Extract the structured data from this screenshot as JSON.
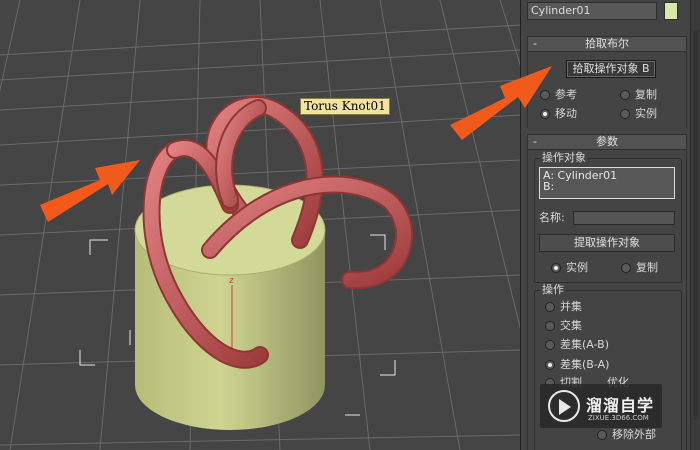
{
  "viewport": {
    "object_label": "Torus Knot01",
    "axis_label": "z"
  },
  "panel": {
    "object_name": "Cylinder01",
    "object_color": "#d8e8a8",
    "pick_rollout": {
      "title": "拾取布尔",
      "collapse_symbol": "-",
      "pick_button": "拾取操作对象 B",
      "radios": [
        {
          "label": "参考",
          "selected": false
        },
        {
          "label": "复制",
          "selected": false
        },
        {
          "label": "移动",
          "selected": true
        },
        {
          "label": "实例",
          "selected": false
        }
      ]
    },
    "params_rollout": {
      "title": "参数",
      "collapse_symbol": "-",
      "operands_group": {
        "title": "操作对象",
        "list": [
          "A: Cylinder01",
          "B:"
        ],
        "name_label": "名称:",
        "name_value": "",
        "extract_button": "提取操作对象",
        "extract_radios": [
          {
            "label": "实例",
            "selected": true
          },
          {
            "label": "复制",
            "selected": false
          }
        ]
      },
      "operation_group": {
        "title": "操作",
        "options": [
          {
            "label": "并集",
            "selected": false
          },
          {
            "label": "交集",
            "selected": false
          },
          {
            "label": "差集(A-B)",
            "selected": false
          },
          {
            "label": "差集(B-A)",
            "selected": true
          },
          {
            "label": "切割",
            "selected": false
          }
        ],
        "cut_suffix": "优化",
        "partial_label": "移除外部"
      }
    }
  },
  "watermark": {
    "title": "溜溜自学",
    "url": "ZIXUE.3D66.COM"
  },
  "colors": {
    "arrow": "#f25a1c",
    "knot": "#c25a5a",
    "cylinder": "#c9d08a"
  }
}
